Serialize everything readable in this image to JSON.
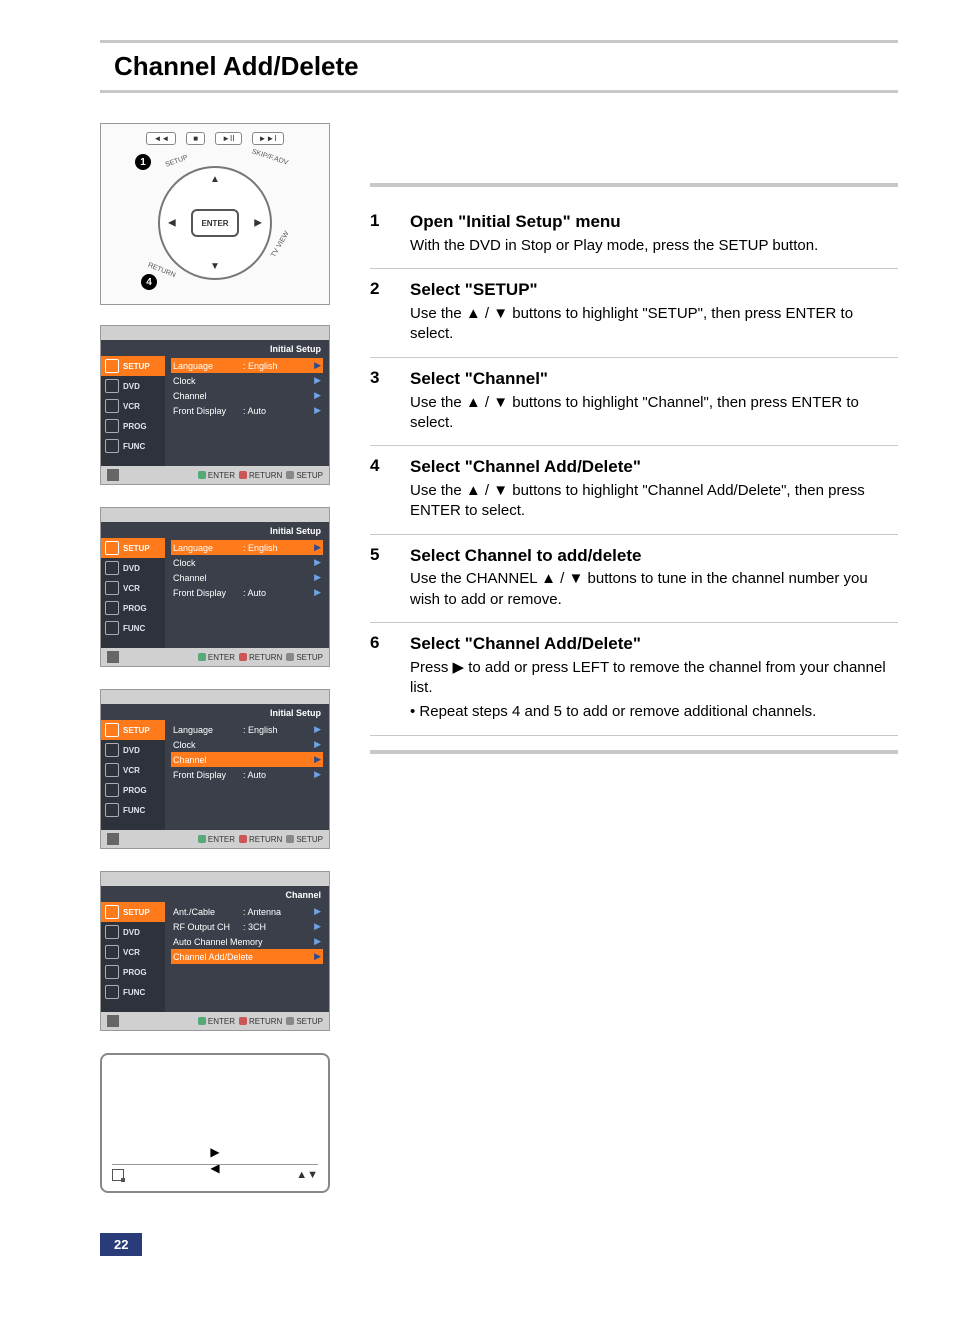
{
  "page_title": "Channel Add/Delete",
  "page_number": "22",
  "remote": {
    "enter": "ENTER",
    "badge1": "1",
    "badge4": "4",
    "lbl_setup": "SETUP",
    "lbl_skip": "SKIP/F.ADV",
    "lbl_return": "RETURN",
    "lbl_tv": "TV VIEW",
    "top_rew": "◄◄",
    "top_stop": "■",
    "top_play": "►II",
    "top_ff": "►►I"
  },
  "osd_side": {
    "setup": "SETUP",
    "dvd": "DVD",
    "vcr": "VCR",
    "prog": "PROG",
    "func": "FUNC"
  },
  "osd_foot": {
    "enter": "ENTER",
    "return": "RETURN",
    "setup": "SETUP"
  },
  "osd1": {
    "title": "Initial Setup",
    "rows": [
      {
        "k": "Language",
        "v": ": English",
        "hl": true
      },
      {
        "k": "Clock",
        "v": "",
        "hl": false
      },
      {
        "k": "Channel",
        "v": "",
        "hl": false
      },
      {
        "k": "Front Display",
        "v": ": Auto",
        "hl": false
      }
    ]
  },
  "osd2": {
    "title": "Initial Setup",
    "rows": [
      {
        "k": "Language",
        "v": ": English",
        "hl": true
      },
      {
        "k": "Clock",
        "v": "",
        "hl": false
      },
      {
        "k": "Channel",
        "v": "",
        "hl": false
      },
      {
        "k": "Front Display",
        "v": ": Auto",
        "hl": false
      }
    ]
  },
  "osd3": {
    "title": "Initial Setup",
    "rows": [
      {
        "k": "Language",
        "v": ": English",
        "hl": false
      },
      {
        "k": "Clock",
        "v": "",
        "hl": false
      },
      {
        "k": "Channel",
        "v": "",
        "hl": true
      },
      {
        "k": "Front Display",
        "v": ": Auto",
        "hl": false
      }
    ]
  },
  "osd4": {
    "title": "Channel",
    "rows": [
      {
        "k": "Ant./Cable",
        "v": ": Antenna",
        "hl": false
      },
      {
        "k": "RF Output CH",
        "v": ": 3CH",
        "hl": false
      },
      {
        "k": "Auto Channel Memory",
        "v": "",
        "hl": false
      },
      {
        "k": "Channel Add/Delete",
        "v": "",
        "hl": true
      }
    ]
  },
  "tvframe": {
    "tri_r": "▶",
    "tri_l": "◀",
    "updown": "▲▼"
  },
  "steps": [
    {
      "n": "1",
      "h": "Open \"Initial Setup\" menu",
      "body": "With the DVD in Stop or Play mode, press the SETUP button."
    },
    {
      "n": "2",
      "h": "Select \"SETUP\"",
      "body": "Use the  ▲ / ▼  buttons to highlight \"SETUP\", then press ENTER to select."
    },
    {
      "n": "3",
      "h": "Select \"Channel\"",
      "body": "Use the  ▲ / ▼  buttons to highlight \"Channel\", then press ENTER to select."
    },
    {
      "n": "4",
      "h": "Select \"Channel Add/Delete\"",
      "body": "Use the  ▲ / ▼  buttons to highlight \"Channel Add/Delete\", then press ENTER to select."
    },
    {
      "n": "5",
      "h": "Select Channel to add/delete",
      "body": "Use the CHANNEL  ▲ / ▼  buttons to tune in the channel number you wish to add or remove."
    },
    {
      "n": "6",
      "h": "Select \"Channel Add/Delete\"",
      "body": "Press ▶ to add or press LEFT to remove the channel from your channel list.",
      "bullet": "•   Repeat steps 4 and 5 to add or remove additional channels."
    }
  ]
}
